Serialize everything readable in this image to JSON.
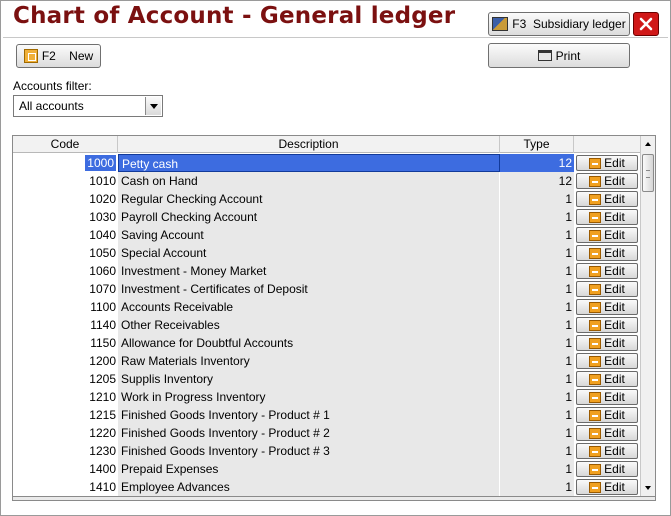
{
  "window": {
    "title": "Chart of Account - General ledger",
    "close_icon": "close-icon",
    "close_color": "#d01818"
  },
  "toolbar": {
    "subsidiary_label": "F3  Subsidiary ledger",
    "subsidiary_icon": "ledger-book-icon",
    "print_label": "Print",
    "print_icon": "printer-icon",
    "new_label": "F2    New",
    "new_icon": "new-document-icon"
  },
  "filter": {
    "label": "Accounts filter:",
    "selected": "All accounts"
  },
  "grid": {
    "columns": [
      "Code",
      "Description",
      "Type"
    ],
    "edit_label": "Edit",
    "edit_icon": "edit-icon",
    "selected_row": 0,
    "rows": [
      {
        "code": "1000",
        "description": "Petty cash",
        "type": "12"
      },
      {
        "code": "1010",
        "description": "Cash on Hand",
        "type": "12"
      },
      {
        "code": "1020",
        "description": "Regular Checking Account",
        "type": "1"
      },
      {
        "code": "1030",
        "description": "Payroll Checking Account",
        "type": "1"
      },
      {
        "code": "1040",
        "description": "Saving Account",
        "type": "1"
      },
      {
        "code": "1050",
        "description": "Special Account",
        "type": "1"
      },
      {
        "code": "1060",
        "description": "Investment - Money Market",
        "type": "1"
      },
      {
        "code": "1070",
        "description": "Investment - Certificates of Deposit",
        "type": "1"
      },
      {
        "code": "1100",
        "description": "Accounts Receivable",
        "type": "1"
      },
      {
        "code": "1140",
        "description": "Other Receivables",
        "type": "1"
      },
      {
        "code": "1150",
        "description": "Allowance for Doubtful Accounts",
        "type": "1"
      },
      {
        "code": "1200",
        "description": "Raw Materials Inventory",
        "type": "1"
      },
      {
        "code": "1205",
        "description": "Supplis Inventory",
        "type": "1"
      },
      {
        "code": "1210",
        "description": "Work in Progress Inventory",
        "type": "1"
      },
      {
        "code": "1215",
        "description": "Finished Goods Inventory - Product # 1",
        "type": "1"
      },
      {
        "code": "1220",
        "description": "Finished Goods Inventory - Product # 2",
        "type": "1"
      },
      {
        "code": "1230",
        "description": "Finished Goods Inventory - Product # 3",
        "type": "1"
      },
      {
        "code": "1400",
        "description": "Prepaid Expenses",
        "type": "1"
      },
      {
        "code": "1410",
        "description": "Employee Advances",
        "type": "1"
      }
    ]
  },
  "colors": {
    "title": "#7b1010",
    "selection": "#3d6ce0",
    "column_shade": "#e8e8e8"
  }
}
